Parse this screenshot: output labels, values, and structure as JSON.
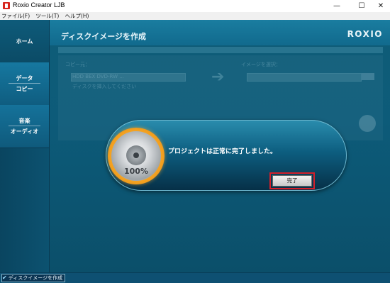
{
  "window": {
    "title": "Roxio Creator LJB",
    "minimize": "—",
    "maximize": "☐",
    "close": "✕"
  },
  "menu": [
    "ファイル(F)",
    "ツール(T)",
    "ヘルプ(H)"
  ],
  "sidebar": {
    "items": [
      {
        "label": "ホーム"
      },
      {
        "label_top": "データ",
        "label_bottom": "コピー"
      },
      {
        "label_top": "音楽",
        "label_bottom": "オーディオ"
      }
    ]
  },
  "header": {
    "title": "ディスクイメージを作成",
    "brand": "ROXIO"
  },
  "background_form": {
    "source_label": "コピー元：",
    "source_value": "HDD BEX DVD-RW ...",
    "source_hint": "ディスクを挿入してください",
    "target_label": "イメージを選択："
  },
  "dialog": {
    "progress_text": "100%",
    "message": "プロジェクトは正常に完了しました。",
    "done_button": "完了"
  },
  "statusbar": {
    "task": "ディスクイメージを作成"
  }
}
